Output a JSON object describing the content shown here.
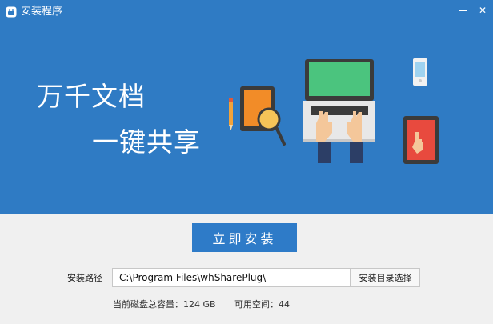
{
  "window": {
    "title": "安装程序",
    "minimize_glyph": "",
    "close_glyph": "✕"
  },
  "banner": {
    "line1": "万千文档",
    "line2": "一键共享",
    "background_color": "#2f7bc4"
  },
  "install": {
    "button_label": "立即安装",
    "button_color": "#2e7bc8"
  },
  "path": {
    "label": "安装路径",
    "value": "C:\\Program Files\\whSharePlug\\",
    "browse_label": "安装目录选择"
  },
  "disk": {
    "total_text": "当前磁盘总容量：124 GB",
    "free_text": "可用空间：44"
  },
  "icons": [
    "app-icon",
    "minimize-icon",
    "close-icon",
    "pencil-icon",
    "tablet-icon",
    "magnifier-icon",
    "laptop-icon",
    "hands-icon",
    "phone-icon",
    "touch-tablet-icon"
  ]
}
